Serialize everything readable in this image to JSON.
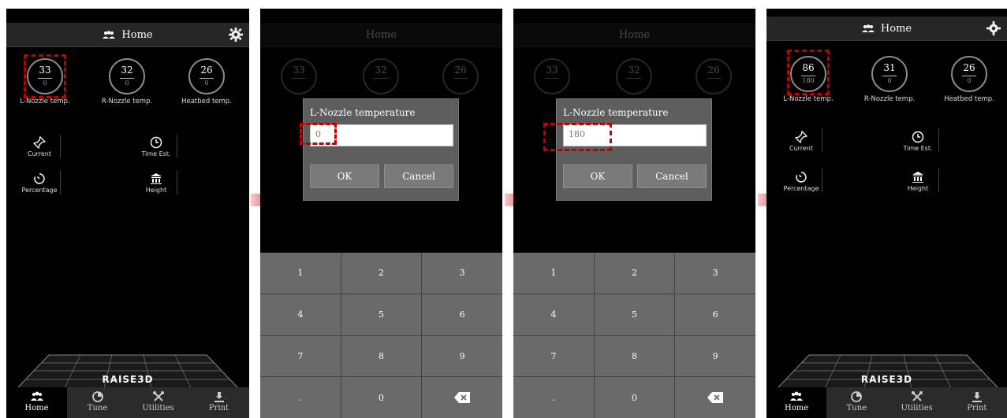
{
  "app": {
    "title": "Home",
    "brand": "RAISE3D"
  },
  "gauges_initial": [
    {
      "value": "33",
      "target": "0",
      "label": "L-Nozzle temp."
    },
    {
      "value": "32",
      "target": "0",
      "label": "R-Nozzle temp."
    },
    {
      "value": "26",
      "target": "0",
      "label": "Heatbed temp."
    }
  ],
  "gauges_final": [
    {
      "value": "86",
      "target": "180",
      "label": "L-Nozzle temp."
    },
    {
      "value": "31",
      "target": "0",
      "label": "R-Nozzle temp."
    },
    {
      "value": "26",
      "target": "0",
      "label": "Heatbed temp."
    }
  ],
  "stats": {
    "current": "Current",
    "time_est": "Time Est.",
    "percentage": "Percentage",
    "height": "Height"
  },
  "nav": {
    "home": "Home",
    "tune": "Tune",
    "utilities": "Utilities",
    "print": "Print"
  },
  "dialog": {
    "title": "L-Nozzle temperature",
    "value_empty": "0",
    "value_entered": "180",
    "ok": "OK",
    "cancel": "Cancel"
  },
  "keypad": {
    "k1": "1",
    "k2": "2",
    "k3": "3",
    "k4": "4",
    "k5": "5",
    "k6": "6",
    "k7": "7",
    "k8": "8",
    "k9": "9",
    "kdot": ".",
    "k0": "0"
  },
  "colors": {
    "highlight": "#c00000",
    "arrow": "#d32027",
    "background": "#000000"
  },
  "icons": [
    "home-icon",
    "gear-icon",
    "pin-icon",
    "clock-icon",
    "timer-icon",
    "monument-icon",
    "tune-icon",
    "utilities-icon",
    "print-icon",
    "backspace-icon"
  ]
}
